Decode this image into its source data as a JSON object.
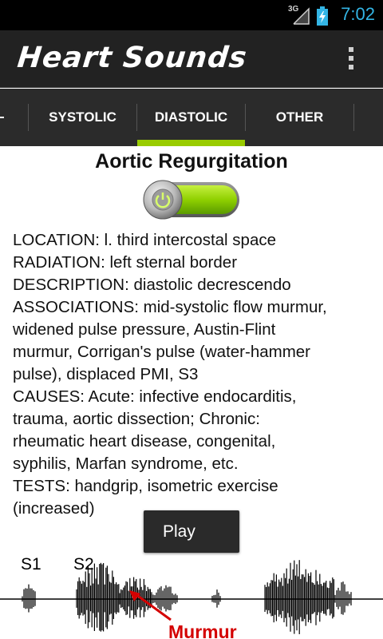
{
  "status_bar": {
    "network": "3G",
    "time": "7:02"
  },
  "app": {
    "title": "Heart Sounds"
  },
  "tabs": [
    {
      "label": "SYSTOLIC",
      "selected": false
    },
    {
      "label": "DIASTOLIC",
      "selected": true
    },
    {
      "label": "OTHER",
      "selected": false
    }
  ],
  "colors": {
    "accent": "#99cc00",
    "status_time": "#33b5e5",
    "murmur": "#d40000"
  },
  "murmur": {
    "title": "Aortic Regurgitation",
    "toggle_on": true,
    "details": [
      "LOCATION: l. third intercostal space",
      "RADIATION: left sternal border",
      "DESCRIPTION: diastolic decrescendo",
      "ASSOCIATIONS: mid-systolic flow murmur,",
      "widened pulse pressure, Austin-Flint",
      "murmur, Corrigan's pulse (water-hammer",
      "pulse), displaced PMI, S3",
      "CAUSES: Acute: infective endocarditis,",
      "trauma, aortic dissection; Chronic:",
      "rheumatic heart disease, congenital,",
      "syphilis, Marfan syndrome, etc.",
      "TESTS: handgrip, isometric exercise",
      "(increased)"
    ]
  },
  "play_button": {
    "label": "Play"
  },
  "waveform": {
    "s1_label": "S1",
    "s2_label": "S2",
    "murmur_label": "Murmur"
  }
}
